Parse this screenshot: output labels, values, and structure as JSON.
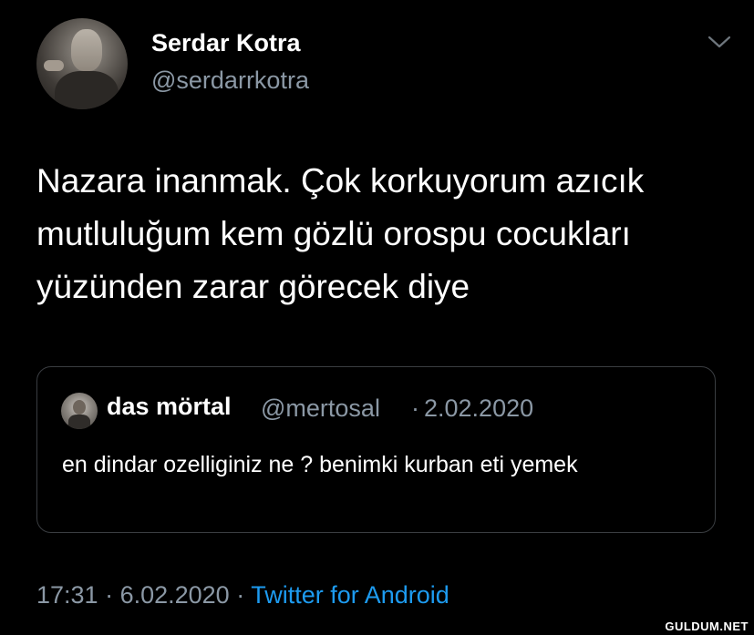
{
  "tweet": {
    "author": {
      "name": "Serdar Kotra",
      "handle": "@serdarrkotra"
    },
    "text": "Nazara inanmak. Çok korkuyorum azıcık mutluluğum kem gözlü orospu cocukları yüzünden zarar görecek diye",
    "menu_icon": "chevron-down-icon"
  },
  "quoted_tweet": {
    "author_name": "das mörtal",
    "author_handle": "@mertosal",
    "separator": "·",
    "date": "2.02.2020",
    "text": "en dindar ozelliginiz ne ? benimki kurban eti yemek"
  },
  "footer": {
    "time": "17:31",
    "separator1": " · ",
    "date": "6.02.2020",
    "separator2": " · ",
    "source": "Twitter for Android"
  },
  "colors": {
    "background": "#000000",
    "text_primary": "#ffffff",
    "text_secondary": "#8b98a5",
    "link": "#1d9bf0",
    "border": "#3a3d41"
  },
  "watermark": "GULDUM.NET"
}
